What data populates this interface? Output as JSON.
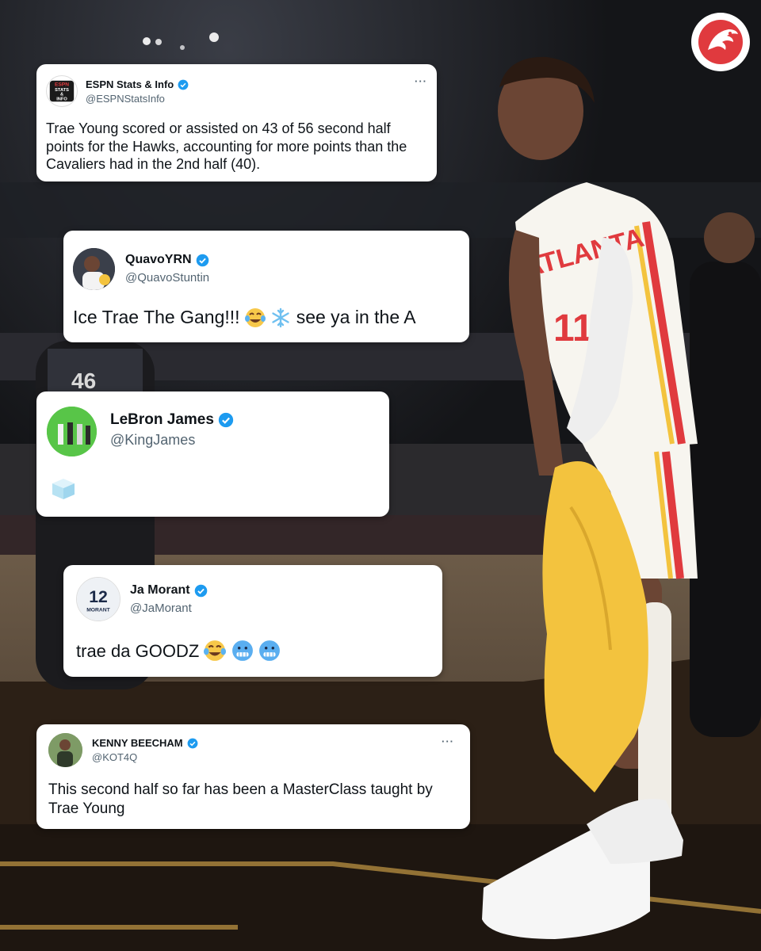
{
  "colors": {
    "hawks_red": "#e03a3e",
    "verified_blue": "#1d9bf0",
    "towel_yellow": "#f3c33e",
    "jersey_white": "#f7f5ef"
  },
  "background": {
    "player_jersey_text": "ATLANTA",
    "player_number": "11",
    "referee_number": "46"
  },
  "logo": {
    "icon": "hawks-logo-icon"
  },
  "tweets": [
    {
      "name": "ESPN Stats & Info",
      "handle": "@ESPNStatsInfo",
      "avatar_lines": [
        "ESPN",
        "STATS",
        "&",
        "INFO"
      ],
      "verified": true,
      "more": "···",
      "text": "Trae Young scored or assisted on 43 of 56 second half points for the Hawks, accounting for more points than the Cavaliers had in the 2nd half (40)."
    },
    {
      "name": "QuavoYRN",
      "handle": "@QuavoStuntin",
      "verified": true,
      "text": "Ice Trae The Gang!!!",
      "emojis": [
        "tears-of-joy-emoji",
        "snowflake-emoji"
      ],
      "text_after": "see ya in the A"
    },
    {
      "name": "LeBron James",
      "handle": "@KingJames",
      "verified": true,
      "emojis": [
        "ice-cube-emoji"
      ]
    },
    {
      "name": "Ja Morant",
      "handle": "@JaMorant",
      "avatar_number": "12",
      "avatar_label": "MORANT",
      "verified": true,
      "text": "trae da GOODZ",
      "emojis": [
        "tears-of-joy-emoji",
        "cold-face-emoji",
        "cold-face-emoji"
      ]
    },
    {
      "name": "KENNY BEECHAM",
      "handle": "@KOT4Q",
      "verified": true,
      "more": "···",
      "text": "This second half so far has been a MasterClass taught by Trae Young"
    }
  ]
}
